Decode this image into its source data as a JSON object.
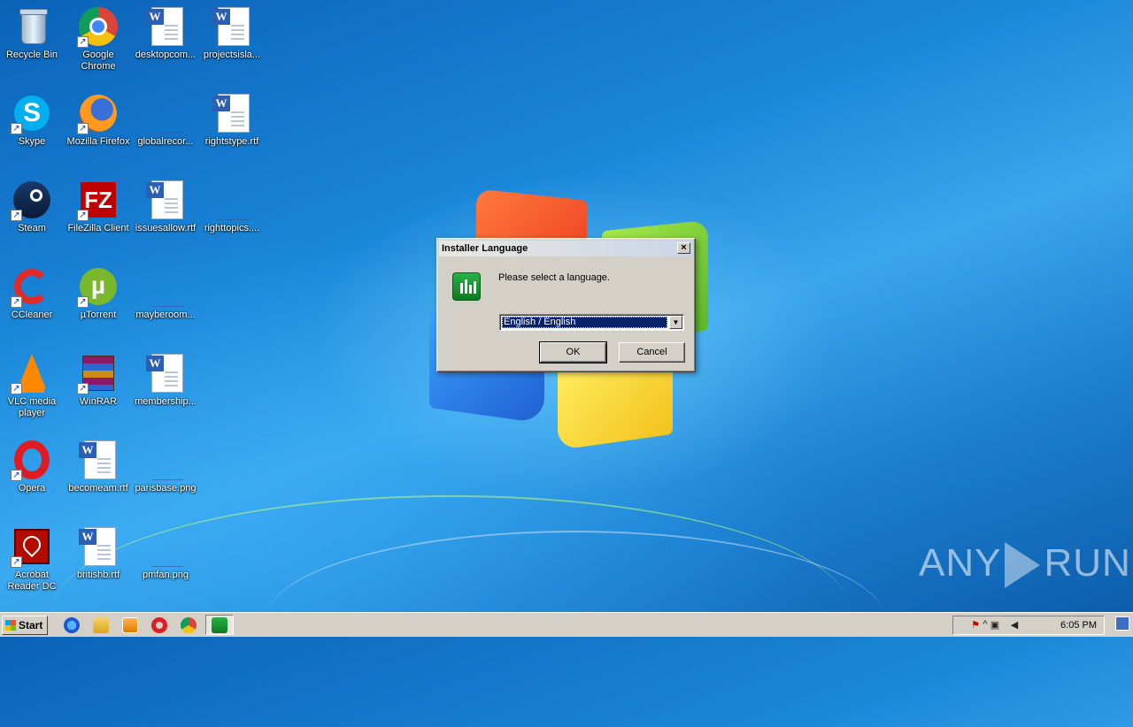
{
  "desktop": {
    "icons": [
      {
        "label": "Recycle Bin",
        "icon": "recycle-bin-icon"
      },
      {
        "label": "Google Chrome",
        "icon": "chrome-icon"
      },
      {
        "label": "desktopcom...",
        "icon": "word-doc-icon"
      },
      {
        "label": "projectsisla...",
        "icon": "word-doc-icon"
      },
      {
        "label": "Skype",
        "icon": "skype-icon"
      },
      {
        "label": "Mozilla Firefox",
        "icon": "firefox-icon"
      },
      {
        "label": "globalrecor...",
        "icon": "file-icon"
      },
      {
        "label": "rightstype.rtf",
        "icon": "word-doc-icon"
      },
      {
        "label": "Steam",
        "icon": "steam-icon"
      },
      {
        "label": "FileZilla Client",
        "icon": "filezilla-icon"
      },
      {
        "label": "issuesallow.rtf",
        "icon": "word-doc-icon"
      },
      {
        "label": "righttopics....",
        "icon": "file-icon"
      },
      {
        "label": "CCleaner",
        "icon": "ccleaner-icon"
      },
      {
        "label": "µTorrent",
        "icon": "utorrent-icon"
      },
      {
        "label": "mayberoom...",
        "icon": "file-icon"
      },
      {
        "label": "VLC media player",
        "icon": "vlc-icon"
      },
      {
        "label": "WinRAR",
        "icon": "winrar-icon"
      },
      {
        "label": "membership...",
        "icon": "word-doc-icon"
      },
      {
        "label": "Opera",
        "icon": "opera-icon"
      },
      {
        "label": "becomeam.rtf",
        "icon": "word-doc-icon"
      },
      {
        "label": "parisbase.png",
        "icon": "file-icon"
      },
      {
        "label": "Acrobat Reader DC",
        "icon": "acrobat-icon"
      },
      {
        "label": "britishb.rtf",
        "icon": "word-doc-icon"
      },
      {
        "label": "pmfan.png",
        "icon": "file-icon"
      }
    ]
  },
  "dialog": {
    "title": "Installer Language",
    "close_label": "×",
    "prompt": "Please select a language.",
    "language_selected": "English / English",
    "ok_label": "OK",
    "cancel_label": "Cancel"
  },
  "watermark": {
    "left": "ANY",
    "right": "RUN"
  },
  "taskbar": {
    "start_label": "Start",
    "pinned": [
      "internet-explorer-icon",
      "explorer-icon",
      "media-player-icon",
      "opera-icon",
      "chrome-icon",
      "installer-app-icon"
    ],
    "tray_expand": "^",
    "clock": "6:05 PM"
  },
  "colors": {
    "dialog_bg": "#d4d0c8",
    "selection": "#0a246a",
    "desktop_blue": "#1a86d8"
  }
}
